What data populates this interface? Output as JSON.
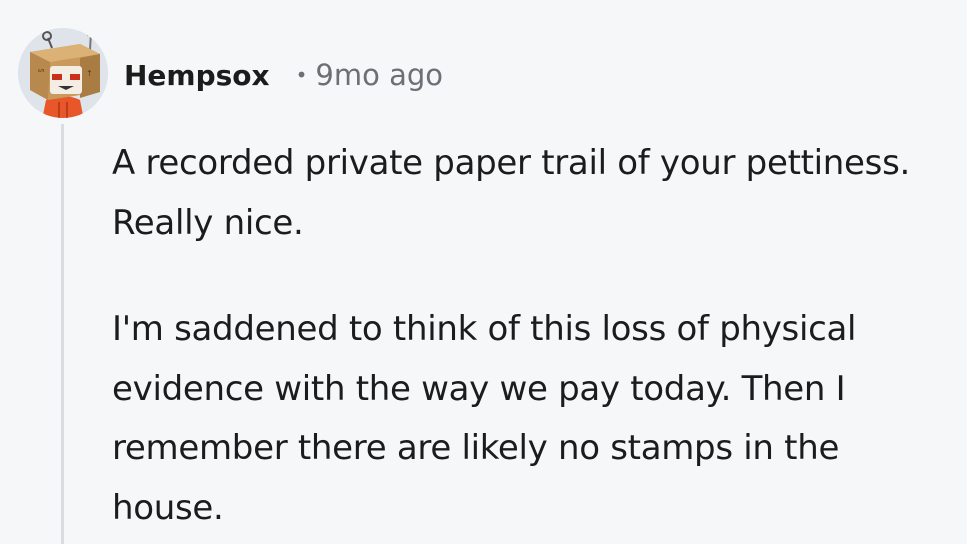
{
  "comment": {
    "author": "Hempsox",
    "separator": "•",
    "timestamp": "9mo ago",
    "avatar_icon": "cardboard-box-robot-avatar-icon",
    "paragraphs": [
      "A recorded private paper trail of your pettiness. Really nice.",
      "I'm saddened to think of this loss of physical evidence with the way we pay today. Then I remember there are likely no stamps in the house."
    ]
  },
  "colors": {
    "background": "#f6f7f8",
    "text": "#1c1c1c",
    "meta": "#6b7075",
    "thread_line": "#dadde0"
  }
}
